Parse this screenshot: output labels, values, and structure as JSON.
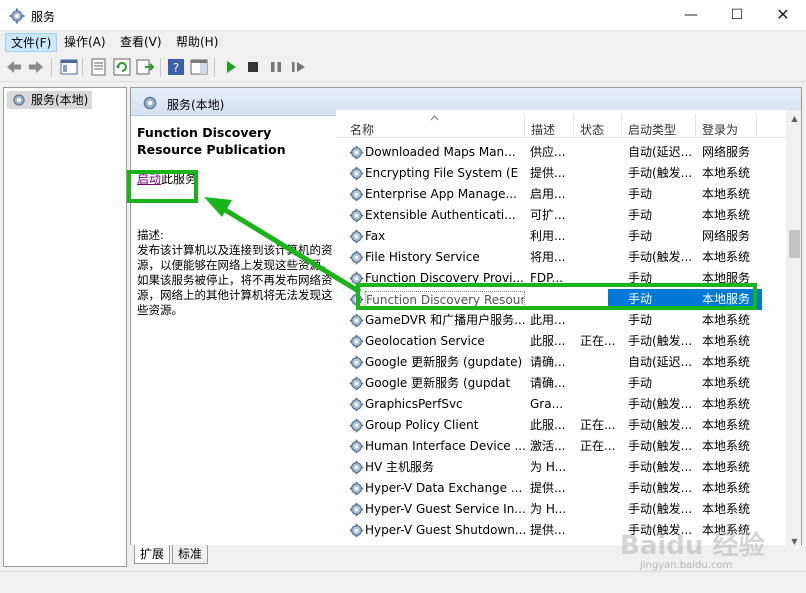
{
  "window": {
    "title": "服务"
  },
  "menu": [
    {
      "label": "文件(F)",
      "active": true
    },
    {
      "label": "操作(A)"
    },
    {
      "label": "查看(V)"
    },
    {
      "label": "帮助(H)"
    }
  ],
  "tree": {
    "root_label": "服务(本地)"
  },
  "pane": {
    "header_title": "服务(本地)"
  },
  "description_panel": {
    "service_name": "Function Discovery Resource Publication",
    "start_link": "启动",
    "start_suffix": "此服务",
    "desc_label": "描述:",
    "desc_text": "发布该计算机以及连接到该计算机的资源，以便能够在网络上发现这些资源。如果该服务被停止，将不再发布网络资源，网络上的其他计算机将无法发现这些资源。"
  },
  "columns": {
    "name": "名称",
    "description": "描述",
    "status": "状态",
    "startup": "启动类型",
    "logon": "登录为"
  },
  "services": [
    {
      "name": "Downloaded Maps Man...",
      "desc": "供应...",
      "status": "",
      "startup": "自动(延迟...",
      "logon": "网络服务"
    },
    {
      "name": "Encrypting File System (E",
      "desc": "提供...",
      "status": "",
      "startup": "手动(触发...",
      "logon": "本地系统"
    },
    {
      "name": "Enterprise App Manage...",
      "desc": "启用...",
      "status": "",
      "startup": "手动",
      "logon": "本地系统"
    },
    {
      "name": "Extensible Authenticati...",
      "desc": "可扩...",
      "status": "",
      "startup": "手动",
      "logon": "本地系统"
    },
    {
      "name": "Fax",
      "desc": "利用...",
      "status": "",
      "startup": "手动",
      "logon": "网络服务"
    },
    {
      "name": "File History Service",
      "desc": "将用...",
      "status": "",
      "startup": "手动(触发...",
      "logon": "本地系统"
    },
    {
      "name": "Function Discovery Provi...",
      "desc": "FDP...",
      "status": "",
      "startup": "手动",
      "logon": "本地服务"
    },
    {
      "name": "Function Discovery Resource Publication",
      "desc": "",
      "status": "",
      "startup": "手动",
      "logon": "本地服务",
      "selected": true
    },
    {
      "name": "GameDVR 和广播用户服务...",
      "desc": "此用...",
      "status": "",
      "startup": "手动",
      "logon": "本地系统"
    },
    {
      "name": "Geolocation Service",
      "desc": "此服...",
      "status": "正在...",
      "startup": "手动(触发...",
      "logon": "本地系统"
    },
    {
      "name": "Google 更新服务 (gupdate)",
      "desc": "请确...",
      "status": "",
      "startup": "自动(延迟...",
      "logon": "本地系统"
    },
    {
      "name": "Google 更新服务 (gupdat",
      "desc": "请确...",
      "status": "",
      "startup": "手动",
      "logon": "本地系统"
    },
    {
      "name": "GraphicsPerfSvc",
      "desc": "Gra...",
      "status": "",
      "startup": "手动(触发...",
      "logon": "本地系统"
    },
    {
      "name": "Group Policy Client",
      "desc": "此服...",
      "status": "正在...",
      "startup": "手动(触发...",
      "logon": "本地系统"
    },
    {
      "name": "Human Interface Device ...",
      "desc": "激活...",
      "status": "正在...",
      "startup": "手动(触发...",
      "logon": "本地系统"
    },
    {
      "name": "HV 主机服务",
      "desc": "为 H...",
      "status": "",
      "startup": "手动(触发...",
      "logon": "本地系统"
    },
    {
      "name": "Hyper-V Data Exchange ...",
      "desc": "提供...",
      "status": "",
      "startup": "手动(触发...",
      "logon": "本地系统"
    },
    {
      "name": "Hyper-V Guest Service In...",
      "desc": "为 H...",
      "status": "",
      "startup": "手动(触发...",
      "logon": "本地系统"
    },
    {
      "name": "Hyper-V Guest Shutdown...",
      "desc": "提供...",
      "status": "",
      "startup": "手动(触发...",
      "logon": "本地系统"
    }
  ],
  "tabs": [
    {
      "label": "扩展",
      "active": true
    },
    {
      "label": "标准"
    }
  ],
  "watermark": {
    "brand": "Baidu 经验",
    "url": "jingyan.baidu.com"
  },
  "colors": {
    "highlight": "#18b418",
    "selection": "#0078d7",
    "link": "#800080"
  }
}
